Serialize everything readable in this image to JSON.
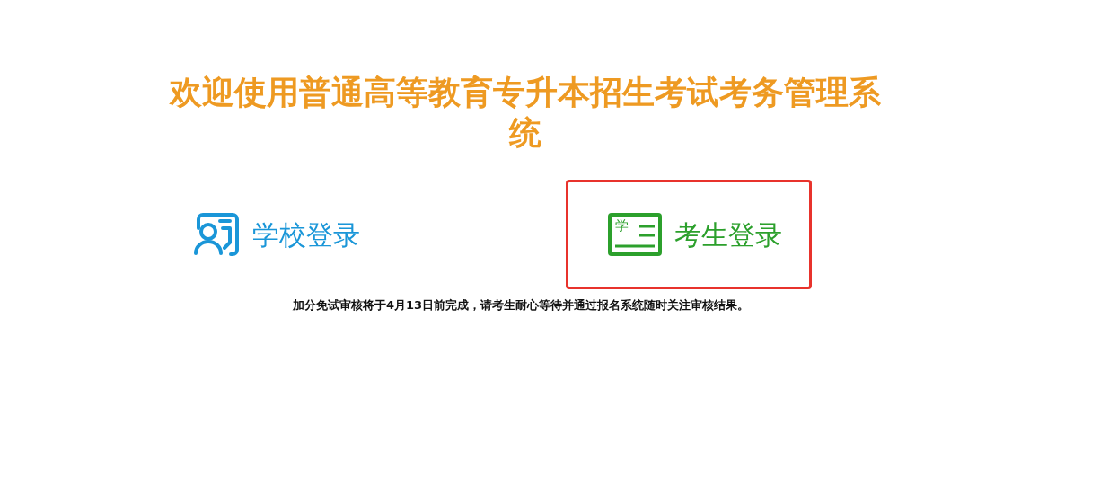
{
  "title": "欢迎使用普通高等教育专升本招生考试考务管理系统",
  "logins": [
    {
      "kind": "school",
      "label": "学校登录",
      "color": "#1a96d8",
      "selected": false
    },
    {
      "kind": "student",
      "label": "考生登录",
      "icon_text": "学",
      "color": "#2ca02c",
      "selected": true
    }
  ],
  "notice": "加分免试审核将于4月13日前完成，请考生耐心等待并通过报名系统随时关注审核结果。"
}
